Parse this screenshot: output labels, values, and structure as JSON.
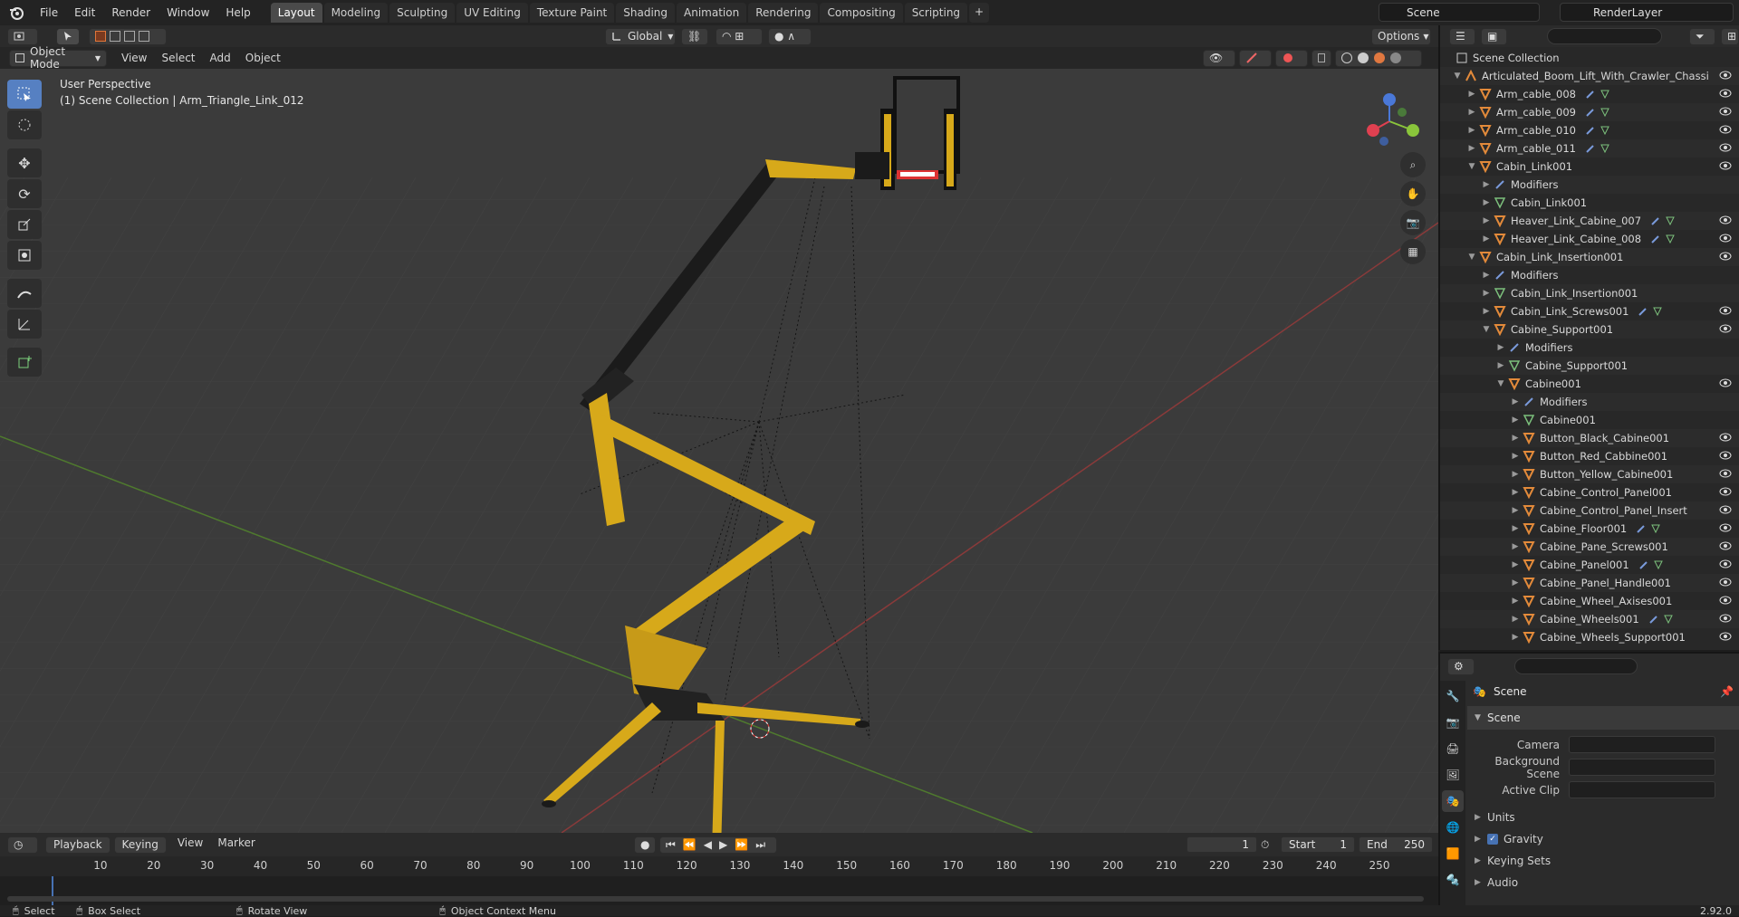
{
  "topbar": {
    "menus": [
      "File",
      "Edit",
      "Render",
      "Window",
      "Help"
    ],
    "tabs": [
      "Layout",
      "Modeling",
      "Sculpting",
      "UV Editing",
      "Texture Paint",
      "Shading",
      "Animation",
      "Rendering",
      "Compositing",
      "Scripting"
    ],
    "active_tab": "Layout",
    "add_tab": "+",
    "scene": "Scene",
    "render_layer": "RenderLayer"
  },
  "viewport_header": {
    "mode": "Object Mode",
    "menus": [
      "View",
      "Select",
      "Add",
      "Object"
    ],
    "transform_orientation": "Global",
    "options": "Options"
  },
  "viewport": {
    "perspective": "User Perspective",
    "context": "(1) Scene Collection | Arm_Triangle_Link_012",
    "colors": {
      "background": "#3b3b3b",
      "grid": "#444444",
      "x_axis": "#8a3a3a",
      "y_axis": "#4f7a2e",
      "model_yellow": "#d7a91a",
      "model_black": "#1b1b1b"
    }
  },
  "outliner": {
    "root": "Scene Collection",
    "items": [
      {
        "label": "Articulated_Boom_Lift_With_Crawler_Chassi",
        "depth": 1,
        "expanded": true,
        "icon": "object-icon",
        "eye": true
      },
      {
        "label": "Arm_cable_008",
        "depth": 2,
        "icon": "mesh-object-icon",
        "eye": true,
        "mods": true
      },
      {
        "label": "Arm_cable_009",
        "depth": 2,
        "icon": "mesh-object-icon",
        "eye": true,
        "mods": true
      },
      {
        "label": "Arm_cable_010",
        "depth": 2,
        "icon": "mesh-object-icon",
        "eye": true,
        "mods": true
      },
      {
        "label": "Arm_cable_011",
        "depth": 2,
        "icon": "mesh-object-icon",
        "eye": true,
        "mods": true
      },
      {
        "label": "Cabin_Link001",
        "depth": 2,
        "expanded": true,
        "icon": "mesh-object-icon",
        "eye": true
      },
      {
        "label": "Modifiers",
        "depth": 3,
        "icon": "wrench-icon",
        "eye": false
      },
      {
        "label": "Cabin_Link001",
        "depth": 3,
        "icon": "mesh-data-icon",
        "eye": false
      },
      {
        "label": "Heaver_Link_Cabine_007",
        "depth": 3,
        "icon": "mesh-object-icon",
        "eye": true,
        "mods": true
      },
      {
        "label": "Heaver_Link_Cabine_008",
        "depth": 3,
        "icon": "mesh-object-icon",
        "eye": true,
        "mods": true
      },
      {
        "label": "Cabin_Link_Insertion001",
        "depth": 2,
        "expanded": true,
        "icon": "mesh-object-icon",
        "eye": true
      },
      {
        "label": "Modifiers",
        "depth": 3,
        "icon": "wrench-icon",
        "eye": false
      },
      {
        "label": "Cabin_Link_Insertion001",
        "depth": 3,
        "icon": "mesh-data-icon",
        "eye": false
      },
      {
        "label": "Cabin_Link_Screws001",
        "depth": 3,
        "icon": "mesh-object-icon",
        "eye": true,
        "mods": true
      },
      {
        "label": "Cabine_Support001",
        "depth": 3,
        "expanded": true,
        "icon": "mesh-object-icon",
        "eye": true
      },
      {
        "label": "Modifiers",
        "depth": 4,
        "icon": "wrench-icon",
        "eye": false
      },
      {
        "label": "Cabine_Support001",
        "depth": 4,
        "icon": "mesh-data-icon",
        "eye": false
      },
      {
        "label": "Cabine001",
        "depth": 4,
        "expanded": true,
        "icon": "mesh-object-icon",
        "eye": true
      },
      {
        "label": "Modifiers",
        "depth": 5,
        "icon": "wrench-icon",
        "eye": false
      },
      {
        "label": "Cabine001",
        "depth": 5,
        "icon": "mesh-data-icon",
        "eye": false
      },
      {
        "label": "Button_Black_Cabine001",
        "depth": 5,
        "icon": "mesh-object-icon",
        "eye": true
      },
      {
        "label": "Button_Red_Cabbine001",
        "depth": 5,
        "icon": "mesh-object-icon",
        "eye": true
      },
      {
        "label": "Button_Yellow_Cabine001",
        "depth": 5,
        "icon": "mesh-object-icon",
        "eye": true
      },
      {
        "label": "Cabine_Control_Panel001",
        "depth": 5,
        "icon": "mesh-object-icon",
        "eye": true
      },
      {
        "label": "Cabine_Control_Panel_Insert",
        "depth": 5,
        "icon": "mesh-object-icon",
        "eye": true
      },
      {
        "label": "Cabine_Floor001",
        "depth": 5,
        "icon": "mesh-object-icon",
        "eye": true,
        "mods": true
      },
      {
        "label": "Cabine_Pane_Screws001",
        "depth": 5,
        "icon": "mesh-object-icon",
        "eye": true
      },
      {
        "label": "Cabine_Panel001",
        "depth": 5,
        "icon": "mesh-object-icon",
        "eye": true,
        "mods": true
      },
      {
        "label": "Cabine_Panel_Handle001",
        "depth": 5,
        "icon": "mesh-object-icon",
        "eye": true
      },
      {
        "label": "Cabine_Wheel_Axises001",
        "depth": 5,
        "icon": "mesh-object-icon",
        "eye": true
      },
      {
        "label": "Cabine_Wheels001",
        "depth": 5,
        "icon": "mesh-object-icon",
        "eye": true,
        "mods": true
      },
      {
        "label": "Cabine_Wheels_Support001",
        "depth": 5,
        "icon": "mesh-object-icon",
        "eye": true
      }
    ]
  },
  "properties": {
    "title": "Scene",
    "panel": "Scene",
    "fields": [
      {
        "label": "Camera",
        "value": ""
      },
      {
        "label": "Background Scene",
        "value": ""
      },
      {
        "label": "Active Clip",
        "value": ""
      }
    ],
    "subpanels": [
      "Units",
      "Gravity",
      "Keying Sets",
      "Audio"
    ],
    "gravity_checked": true
  },
  "timeline": {
    "menus": [
      "Playback",
      "Keying",
      "View",
      "Marker"
    ],
    "current_frame": "1",
    "start_label": "Start",
    "start": "1",
    "end_label": "End",
    "end": "250",
    "ticks": [
      "10",
      "20",
      "30",
      "40",
      "50",
      "60",
      "70",
      "80",
      "90",
      "100",
      "110",
      "120",
      "130",
      "140",
      "150",
      "160",
      "170",
      "180",
      "190",
      "200",
      "210",
      "220",
      "230",
      "240",
      "250"
    ]
  },
  "statusbar": {
    "select": "Select",
    "box_select": "Box Select",
    "rotate": "Rotate View",
    "context_menu": "Object Context Menu",
    "version": "2.92.0"
  }
}
